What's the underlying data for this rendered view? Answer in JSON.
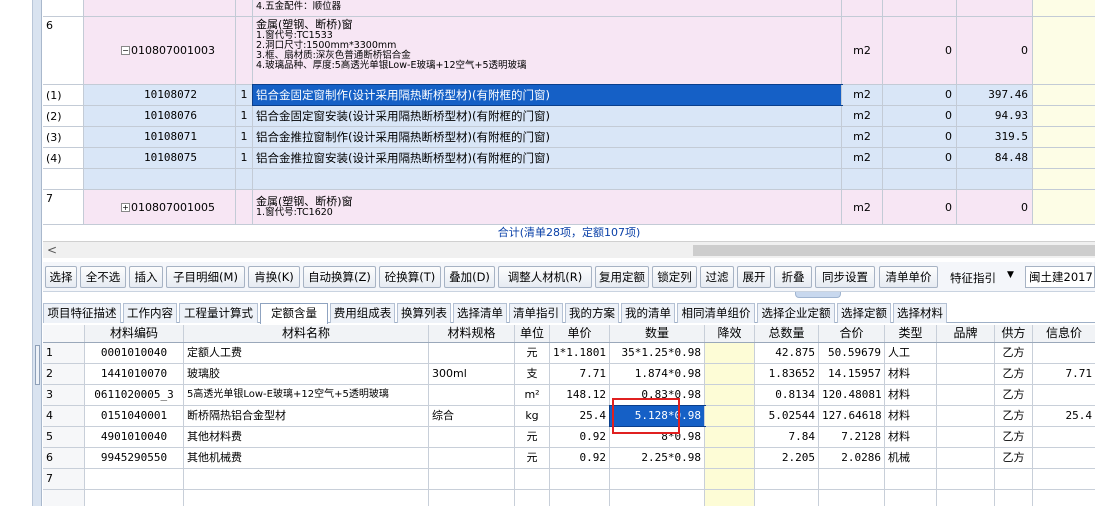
{
  "top_grid": {
    "rows": [
      {
        "no": "",
        "code": "",
        "n": "",
        "name_lines": [
          "4.五金配件：顺位器"
        ],
        "unit": "",
        "qty": "",
        "price": ""
      },
      {
        "no": "6",
        "code": "010807001003",
        "n": "",
        "name_lines": [
          "金属(塑钢、断桥)窗",
          "1.窗代号:TC1533",
          "2.洞口尺寸:1500mm*3300mm",
          "3.框、扇材质:深灰色普通断桥铝合金",
          "4.玻璃品种、厚度:5高透光单银Low-E玻璃+12空气+5透明玻璃"
        ],
        "unit": "m2",
        "qty": "0",
        "price": "0"
      },
      {
        "no": "(1)",
        "code": "10108072",
        "n": "1",
        "name": "铝合金固定窗制作(设计采用隔热断桥型材)(有附框的门窗)",
        "unit": "m2",
        "qty": "0",
        "price": "397.46"
      },
      {
        "no": "(2)",
        "code": "10108076",
        "n": "1",
        "name": "铝合金固定窗安装(设计采用隔热断桥型材)(有附框的门窗)",
        "unit": "m2",
        "qty": "0",
        "price": "94.93"
      },
      {
        "no": "(3)",
        "code": "10108071",
        "n": "1",
        "name": "铝合金推拉窗制作(设计采用隔热断桥型材)(有附框的门窗)",
        "unit": "m2",
        "qty": "0",
        "price": "319.5"
      },
      {
        "no": "(4)",
        "code": "10108075",
        "n": "1",
        "name": "铝合金推拉窗安装(设计采用隔热断桥型材)(有附框的门窗)",
        "unit": "m2",
        "qty": "0",
        "price": "84.48"
      },
      {
        "no": "7",
        "code": "010807001005",
        "n": "",
        "name_lines": [
          "金属(塑钢、断桥)窗",
          "1.窗代号:TC1620"
        ],
        "unit": "m2",
        "qty": "0",
        "price": "0"
      }
    ],
    "total_text": "合计(清单28项，定额107项)"
  },
  "toolbar": {
    "buttons": [
      "选择",
      "全不选",
      "插入",
      "子目明细(M)",
      "肯换(K)",
      "自动换算(Z)",
      "砼换算(T)",
      "叠加(D)",
      "调整人材机(R)",
      "复用定额",
      "锁定列",
      "过滤",
      "展开",
      "折叠",
      "同步设置",
      "清单单价"
    ],
    "label": "特征指引",
    "select_value": "闽土建2017"
  },
  "tabs": [
    "项目特征描述",
    "工作内容",
    "工程量计算式",
    "定额含量",
    "费用组成表",
    "换算列表",
    "选择清单",
    "清单指引",
    "我的方案",
    "我的清单",
    "相同清单组价",
    "选择企业定额",
    "选择定额",
    "选择材料"
  ],
  "active_tab": "定额含量",
  "materials": {
    "headers": [
      "",
      "材料编码",
      "材料名称",
      "材料规格",
      "单位",
      "单价",
      "数量",
      "降效",
      "总数量",
      "合价",
      "类型",
      "品牌",
      "供方",
      "信息价"
    ],
    "rows": [
      {
        "no": "1",
        "code": "0001010040",
        "name": "定额人工费",
        "spec": "",
        "unit": "元",
        "price": "1*1.1801",
        "qty": "35*1.25*0.98",
        "drop": "",
        "total": "42.875",
        "sum": "50.59679",
        "type": "人工",
        "brand": "",
        "supplier": "乙方",
        "info": ""
      },
      {
        "no": "2",
        "code": "1441010070",
        "name": "玻璃胶",
        "spec": "300ml",
        "unit": "支",
        "price": "7.71",
        "qty": "1.874*0.98",
        "drop": "",
        "total": "1.83652",
        "sum": "14.15957",
        "type": "材料",
        "brand": "",
        "supplier": "乙方",
        "info": "7.71"
      },
      {
        "no": "3",
        "code": "0611020005_3",
        "name": "5高透光单银Low-E玻璃+12空气+5透明玻璃",
        "spec": "",
        "unit": "m²",
        "price": "148.12",
        "qty": "0.83*0.98",
        "drop": "",
        "total": "0.8134",
        "sum": "120.48081",
        "type": "材料",
        "brand": "",
        "supplier": "乙方",
        "info": ""
      },
      {
        "no": "4",
        "code": "0151040001",
        "name": "断桥隔热铝合金型材",
        "spec": "综合",
        "unit": "kg",
        "price": "25.4",
        "qty": "5.128*0.98",
        "drop": "",
        "total": "5.02544",
        "sum": "127.64618",
        "type": "材料",
        "brand": "",
        "supplier": "乙方",
        "info": "25.4"
      },
      {
        "no": "5",
        "code": "4901010040",
        "name": "其他材料费",
        "spec": "",
        "unit": "元",
        "price": "0.92",
        "qty": "8*0.98",
        "drop": "",
        "total": "7.84",
        "sum": "7.2128",
        "type": "材料",
        "brand": "",
        "supplier": "乙方",
        "info": ""
      },
      {
        "no": "6",
        "code": "9945290550",
        "name": "其他机械费",
        "spec": "",
        "unit": "元",
        "price": "0.92",
        "qty": "2.25*0.98",
        "drop": "",
        "total": "2.205",
        "sum": "2.0286",
        "type": "机械",
        "brand": "",
        "supplier": "乙方",
        "info": ""
      },
      {
        "no": "7",
        "code": "",
        "name": "",
        "spec": "",
        "unit": "",
        "price": "",
        "qty": "",
        "drop": "",
        "total": "",
        "sum": "",
        "type": "",
        "brand": "",
        "supplier": "",
        "info": ""
      }
    ]
  },
  "ui": {
    "scroll_left_arrow": "<",
    "dropdown_arrow": "▼",
    "expand_glyph": "−",
    "collapse_glyph": "+"
  }
}
